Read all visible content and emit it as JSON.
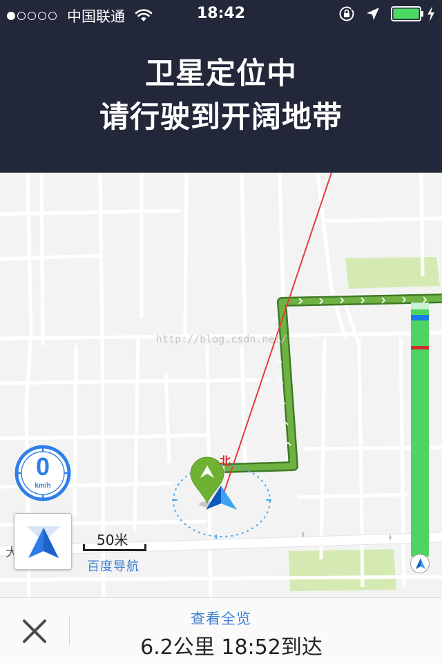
{
  "status_bar": {
    "signal_filled": 1,
    "signal_total": 5,
    "carrier": "中国联通",
    "time": "18:42",
    "battery_level": 1.0
  },
  "banner": {
    "line1": "卫星定位中",
    "line2": "请行驶到开阔地带"
  },
  "map": {
    "watermark": "http://blog.csdn.net/",
    "north_label": "北",
    "speed": {
      "value": "0",
      "unit": "km/h"
    },
    "scale": {
      "label": "50米"
    },
    "brand": "百度导航",
    "route_progress": {
      "traveled_fraction": 0.0,
      "blue_marker_fraction": 0.05,
      "red_marker_fraction": 0.17
    }
  },
  "bottom_bar": {
    "overview_label": "查看全览",
    "trip_summary": "6.2公里 18:52到达"
  },
  "colors": {
    "header_bg": "#222739",
    "route_green": "#5e9e3a",
    "progress_green": "#4fd463",
    "accent_blue": "#2f7fe8",
    "link_blue": "#3d7fcf",
    "alert_red": "#e02020",
    "park_green": "#d5eab2"
  },
  "icons": {
    "wifi": "wifi-icon",
    "lock_rotation": "rotation-lock-icon",
    "location": "location-arrow-icon",
    "battery": "battery-icon",
    "charging": "charging-bolt-icon",
    "compass": "compass-arrow-icon",
    "destination": "destination-pin-icon",
    "vehicle": "vehicle-arrow-icon",
    "close": "close-icon"
  }
}
